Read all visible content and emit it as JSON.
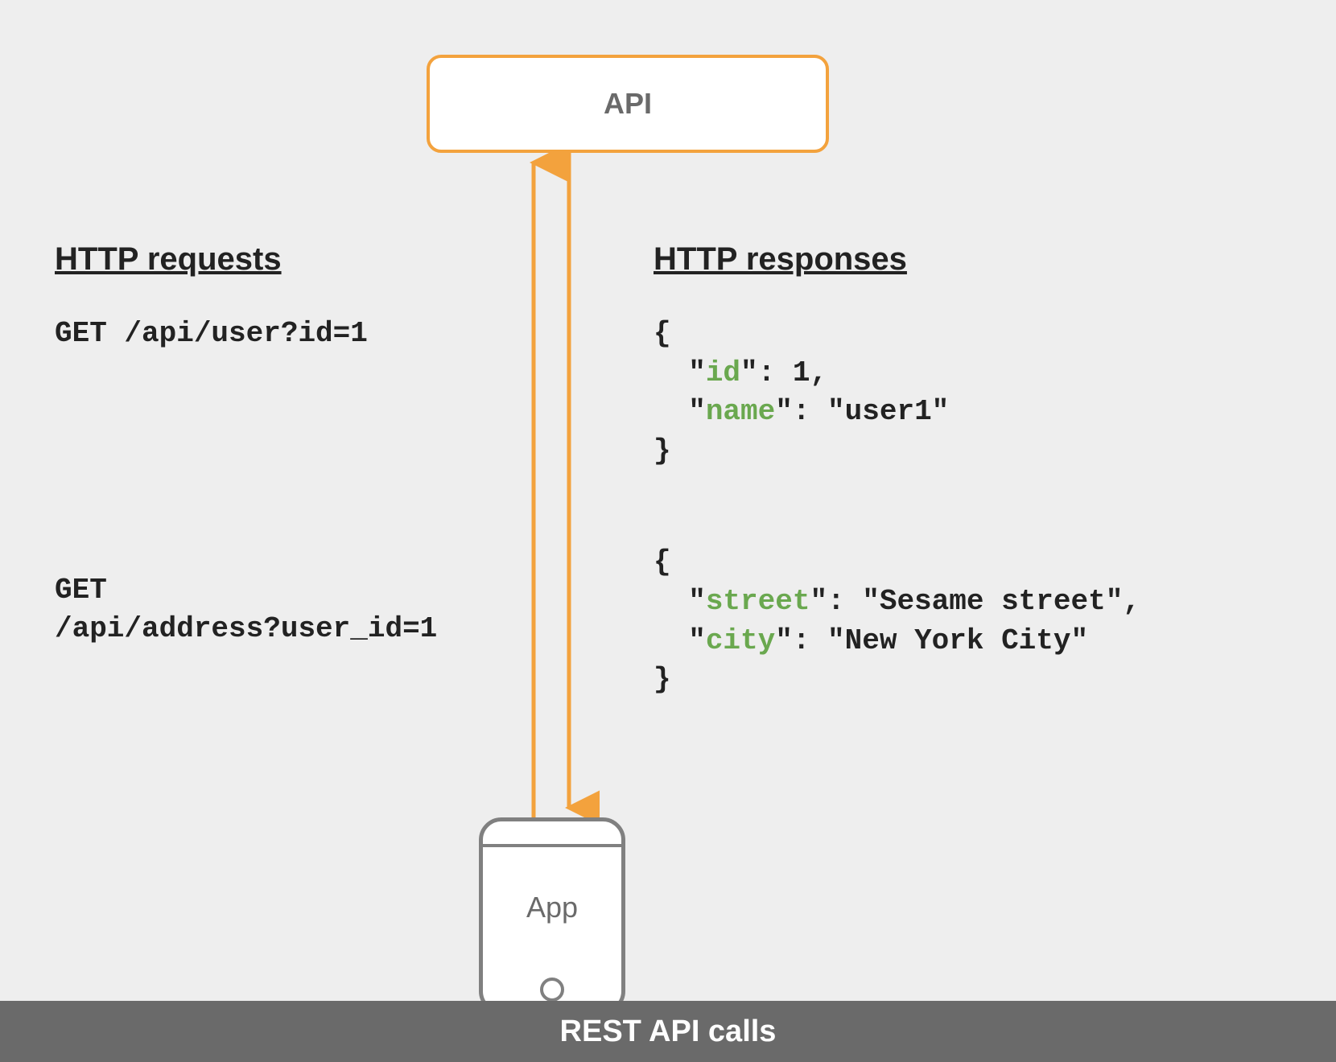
{
  "api_label": "API",
  "app_label": "App",
  "footer": "REST API calls",
  "requests_title": "HTTP requests",
  "responses_title": "HTTP responses",
  "requests": [
    {
      "method": "GET",
      "path": "/api/user?id=1",
      "multiline": false
    },
    {
      "method": "GET",
      "path": "/api/address?user_id=1",
      "multiline": true
    }
  ],
  "responses": [
    {
      "fields": [
        {
          "key": "id",
          "value": "1",
          "is_string": false
        },
        {
          "key": "name",
          "value": "user1",
          "is_string": true
        }
      ]
    },
    {
      "fields": [
        {
          "key": "street",
          "value": "Sesame street",
          "is_string": true
        },
        {
          "key": "city",
          "value": "New York City",
          "is_string": true
        }
      ]
    }
  ],
  "colors": {
    "accent": "#F3A23D",
    "key": "#6aa84f"
  }
}
